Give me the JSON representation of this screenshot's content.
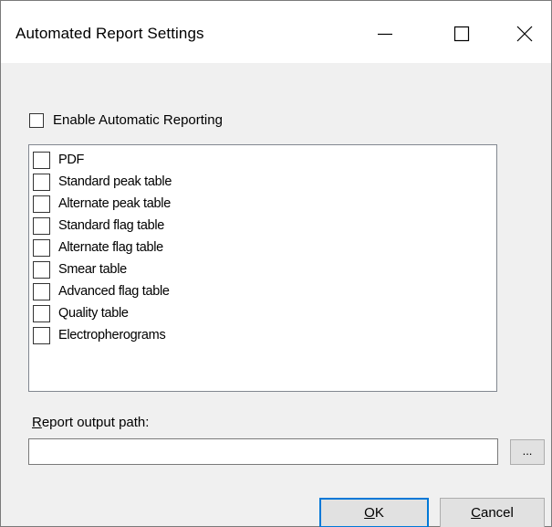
{
  "window": {
    "title": "Automated Report Settings"
  },
  "titlebar_buttons": {
    "minimize_icon": "minimize-icon",
    "maximize_icon": "maximize-icon",
    "close_icon": "close-icon"
  },
  "enable": {
    "label": "Enable Automatic Reporting",
    "checked": false
  },
  "report_types": [
    {
      "label": "PDF",
      "checked": false
    },
    {
      "label": "Standard peak table",
      "checked": false
    },
    {
      "label": "Alternate peak table",
      "checked": false
    },
    {
      "label": "Standard flag table",
      "checked": false
    },
    {
      "label": "Alternate flag table",
      "checked": false
    },
    {
      "label": "Smear table",
      "checked": false
    },
    {
      "label": "Advanced flag table",
      "checked": false
    },
    {
      "label": "Quality table",
      "checked": false
    },
    {
      "label": "Electropherograms",
      "checked": false
    }
  ],
  "output_path": {
    "label_mnemonic": "R",
    "label_rest": "eport output path:",
    "value": "",
    "browse_label": "..."
  },
  "buttons": {
    "ok_mnemonic": "O",
    "ok_rest": "K",
    "cancel_mnemonic": "C",
    "cancel_rest": "ancel"
  },
  "colors": {
    "default_button_border": "#0078d7",
    "window_background": "#f0f0f0"
  }
}
